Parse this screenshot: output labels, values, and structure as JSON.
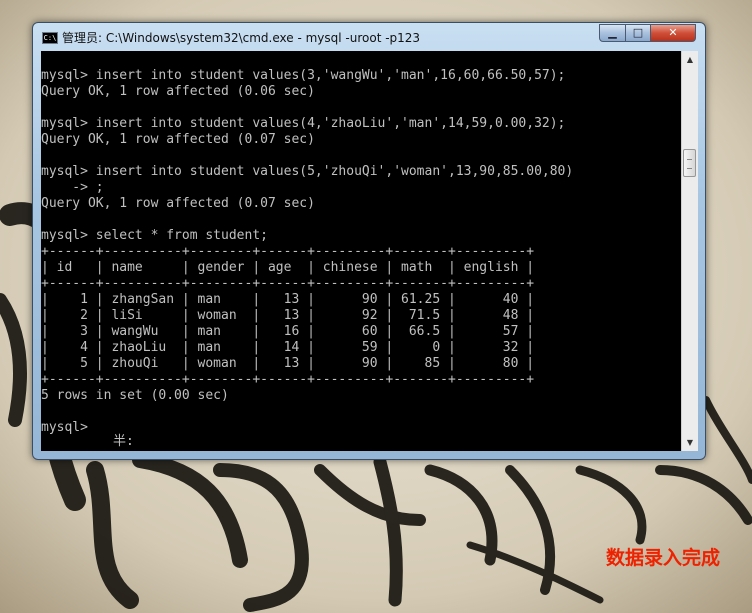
{
  "window": {
    "title": "管理员: C:\\Windows\\system32\\cmd.exe - mysql  -uroot -p123",
    "icon": "cmd-icon",
    "controls": {
      "minimize": "minimize-icon",
      "maximize": "maximize-icon",
      "close": "close-icon"
    }
  },
  "console": {
    "lines": [
      "mysql> insert into student values(3,'wangWu','man',16,60,66.50,57);",
      "Query OK, 1 row affected (0.06 sec)",
      "",
      "mysql> insert into student values(4,'zhaoLiu','man',14,59,0.00,32);",
      "Query OK, 1 row affected (0.07 sec)",
      "",
      "mysql> insert into student values(5,'zhouQi','woman',13,90,85.00,80)",
      "    -> ;",
      "Query OK, 1 row affected (0.07 sec)",
      "",
      "mysql> select * from student;",
      "+------+----------+--------+------+---------+-------+---------+",
      "| id   | name     | gender | age  | chinese | math  | english |",
      "+------+----------+--------+------+---------+-------+---------+",
      "|    1 | zhangSan | man    |   13 |      90 | 61.25 |      40 |",
      "|    2 | liSi     | woman  |   13 |      92 |  71.5 |      48 |",
      "|    3 | wangWu   | man    |   16 |      60 |  66.5 |      57 |",
      "|    4 | zhaoLiu  | man    |   14 |      59 |     0 |      32 |",
      "|    5 | zhouQi   | woman  |   13 |      90 |    85 |      80 |",
      "+------+----------+--------+------+---------+-------+---------+",
      "5 rows in set (0.00 sec)",
      "",
      "mysql>"
    ],
    "ime_status": "半:"
  },
  "caption": "数据录入完成",
  "colors": {
    "console_bg": "#000000",
    "console_text": "#c0c0c0",
    "caption": "#ee2200",
    "close_button": "#c8452f"
  }
}
